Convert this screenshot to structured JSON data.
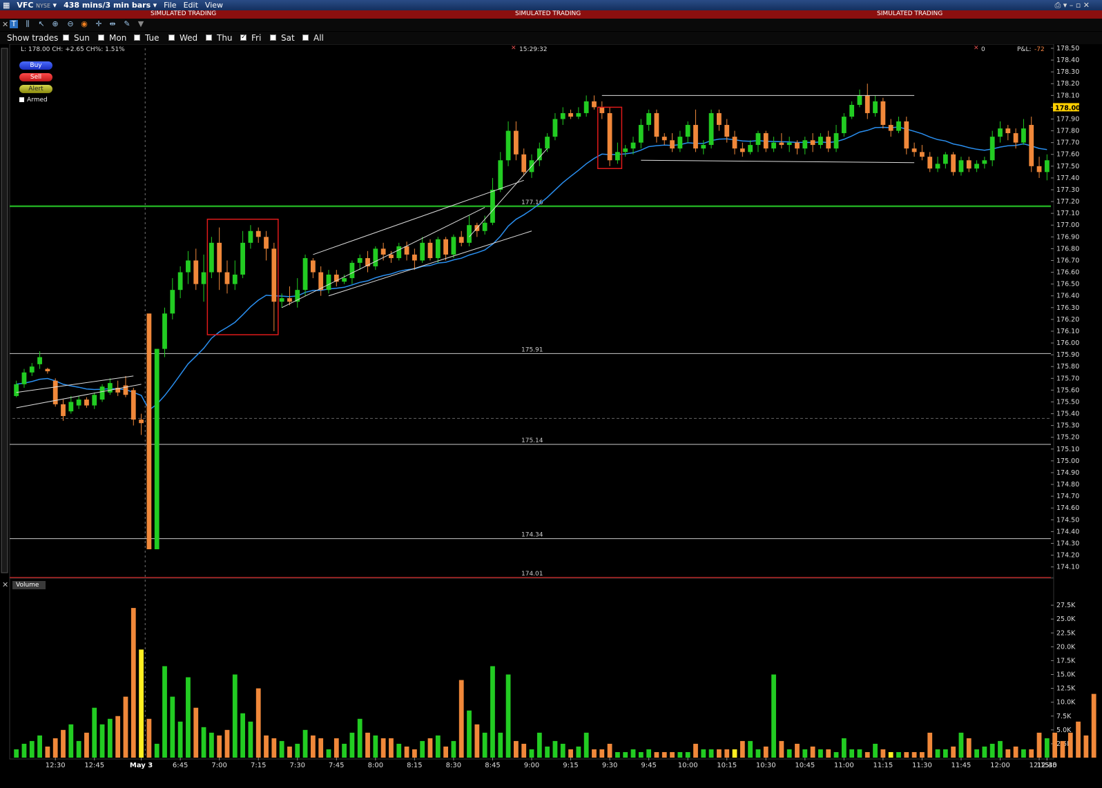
{
  "window": {
    "symbol": "VFC",
    "exchange": "NYSE",
    "period": "438 mins/3 min bars",
    "menu": [
      "File",
      "Edit",
      "View"
    ]
  },
  "banner": {
    "text": "SIMULATED TRADING"
  },
  "toolbar_icons": [
    "chart-icon",
    "bar-chart-icon",
    "cursor-icon",
    "zoom-in-icon",
    "zoom-out-icon",
    "globe-icon",
    "crosshair-icon",
    "arrows-icon",
    "wrench-icon",
    "dropdown-icon"
  ],
  "filters": {
    "label": "Show trades",
    "days": [
      {
        "name": "Sun",
        "checked": false
      },
      {
        "name": "Mon",
        "checked": false
      },
      {
        "name": "Tue",
        "checked": false
      },
      {
        "name": "Wed",
        "checked": false
      },
      {
        "name": "Thu",
        "checked": false
      },
      {
        "name": "Fri",
        "checked": true
      },
      {
        "name": "Sat",
        "checked": false
      },
      {
        "name": "All",
        "checked": false
      }
    ]
  },
  "info": {
    "quote": "L: 178.00   CH: +2.65  CH%: 1.51%",
    "time": "15:29:32",
    "position": "0",
    "pnl_label": "P&L:",
    "pnl_value": "-72"
  },
  "order_buttons": {
    "buy": "Buy",
    "sell": "Sell",
    "alert": "Alert",
    "armed": "Armed"
  },
  "volume_panel": {
    "label": "Volume"
  },
  "colors": {
    "up": "#22cc22",
    "down": "#f0883a",
    "ema": "#2a8ff0",
    "support": "#22aa22",
    "last_price_bg": "#ffd000",
    "boxes": "#e01a1a"
  },
  "chart_data": {
    "type": "candlestick",
    "ylim": [
      174.01,
      178.5
    ],
    "y_ticks": [
      "178.50",
      "178.40",
      "178.30",
      "178.20",
      "178.10",
      "178.00",
      "177.90",
      "177.80",
      "177.70",
      "177.60",
      "177.50",
      "177.40",
      "177.30",
      "177.20",
      "177.10",
      "177.00",
      "176.90",
      "176.80",
      "176.70",
      "176.60",
      "176.50",
      "176.40",
      "176.30",
      "176.20",
      "176.10",
      "176.00",
      "175.90",
      "175.80",
      "175.70",
      "175.60",
      "175.50",
      "175.40",
      "175.30",
      "175.20",
      "175.10",
      "175.00",
      "174.90",
      "174.80",
      "174.70",
      "174.60",
      "174.50",
      "174.40",
      "174.30",
      "174.20",
      "174.10"
    ],
    "last_price": "178.00",
    "x_ticks": [
      "12:30",
      "12:45",
      "May 3",
      "6:45",
      "7:00",
      "7:15",
      "7:30",
      "7:45",
      "8:00",
      "8:15",
      "8:30",
      "8:45",
      "9:00",
      "9:15",
      "9:30",
      "9:45",
      "10:00",
      "10:15",
      "10:30",
      "10:45",
      "11:00",
      "11:15",
      "11:30",
      "11:45",
      "12:00",
      "12:15",
      "12:30",
      "12:45"
    ],
    "levels": [
      {
        "value": 177.16,
        "label": "177.16"
      },
      {
        "value": 175.91,
        "label": "175.91"
      },
      {
        "value": 175.14,
        "label": "175.14"
      },
      {
        "value": 174.34,
        "label": "174.34"
      },
      {
        "value": 174.01,
        "label": "174.01"
      }
    ],
    "volume_ticks": [
      "27.5K",
      "25.0K",
      "22.5K",
      "20.0K",
      "17.5K",
      "15.0K",
      "12.5K",
      "10.0K",
      "7.5K",
      "5.0K",
      "2.5K"
    ],
    "volume_max": 30000,
    "candles": [
      [
        175.55,
        175.65,
        175.54,
        175.68
      ],
      [
        175.65,
        175.75,
        175.62,
        175.78
      ],
      [
        175.75,
        175.8,
        175.72,
        175.83
      ],
      [
        175.82,
        175.88,
        175.78,
        175.93
      ],
      [
        175.78,
        175.76,
        175.74,
        175.79
      ],
      [
        175.68,
        175.48,
        175.46,
        175.7
      ],
      [
        175.48,
        175.38,
        175.34,
        175.52
      ],
      [
        175.42,
        175.5,
        175.4,
        175.55
      ],
      [
        175.47,
        175.52,
        175.44,
        175.55
      ],
      [
        175.52,
        175.47,
        175.45,
        175.54
      ],
      [
        175.47,
        175.56,
        175.44,
        175.58
      ],
      [
        175.52,
        175.63,
        175.5,
        175.65
      ],
      [
        175.58,
        175.66,
        175.56,
        175.7
      ],
      [
        175.62,
        175.58,
        175.55,
        175.68
      ],
      [
        175.64,
        175.56,
        175.54,
        175.72
      ],
      [
        175.6,
        175.35,
        175.3,
        175.62
      ],
      [
        175.35,
        175.32,
        175.22,
        175.4
      ],
      [
        176.25,
        174.25,
        174.25,
        176.25
      ],
      [
        174.25,
        175.95,
        174.25,
        175.95
      ],
      [
        175.95,
        176.25,
        175.88,
        176.3
      ],
      [
        176.25,
        176.45,
        176.2,
        176.55
      ],
      [
        176.45,
        176.6,
        176.38,
        176.65
      ],
      [
        176.6,
        176.7,
        176.5,
        176.78
      ],
      [
        176.7,
        176.5,
        176.45,
        176.8
      ],
      [
        176.5,
        176.6,
        176.35,
        176.75
      ],
      [
        176.6,
        176.85,
        176.55,
        176.9
      ],
      [
        176.85,
        176.6,
        176.45,
        176.98
      ],
      [
        176.6,
        176.5,
        176.42,
        176.7
      ],
      [
        176.5,
        176.58,
        176.45,
        176.7
      ],
      [
        176.58,
        176.85,
        176.55,
        176.95
      ],
      [
        176.85,
        176.95,
        176.8,
        177.0
      ],
      [
        176.95,
        176.9,
        176.85,
        176.98
      ],
      [
        176.9,
        176.8,
        176.7,
        176.95
      ],
      [
        176.8,
        176.35,
        176.1,
        176.85
      ],
      [
        176.35,
        176.38,
        176.3,
        176.42
      ],
      [
        176.38,
        176.35,
        176.32,
        176.48
      ],
      [
        176.35,
        176.45,
        176.3,
        176.55
      ],
      [
        176.45,
        176.72,
        176.4,
        176.75
      ],
      [
        176.7,
        176.6,
        176.55,
        176.72
      ],
      [
        176.6,
        176.45,
        176.4,
        176.65
      ],
      [
        176.45,
        176.58,
        176.42,
        176.62
      ],
      [
        176.58,
        176.52,
        176.48,
        176.62
      ],
      [
        176.52,
        176.55,
        176.5,
        176.58
      ],
      [
        176.55,
        176.68,
        176.5,
        176.7
      ],
      [
        176.68,
        176.72,
        176.62,
        176.75
      ],
      [
        176.72,
        176.65,
        176.6,
        176.78
      ],
      [
        176.65,
        176.8,
        176.62,
        176.82
      ],
      [
        176.8,
        176.75,
        176.7,
        176.85
      ],
      [
        176.75,
        176.72,
        176.68,
        176.78
      ],
      [
        176.72,
        176.82,
        176.7,
        176.85
      ],
      [
        176.82,
        176.75,
        176.7,
        176.86
      ],
      [
        176.75,
        176.7,
        176.62,
        176.8
      ],
      [
        176.7,
        176.85,
        176.68,
        176.9
      ],
      [
        176.85,
        176.72,
        176.7,
        176.88
      ],
      [
        176.72,
        176.88,
        176.68,
        176.9
      ],
      [
        176.88,
        176.75,
        176.7,
        176.9
      ],
      [
        176.75,
        176.9,
        176.72,
        176.92
      ],
      [
        176.9,
        176.85,
        176.82,
        176.95
      ],
      [
        176.85,
        177.0,
        176.82,
        177.08
      ],
      [
        177.0,
        176.95,
        176.9,
        177.02
      ],
      [
        176.95,
        177.02,
        176.92,
        177.08
      ],
      [
        177.02,
        177.3,
        177.0,
        177.4
      ],
      [
        177.3,
        177.55,
        177.28,
        177.62
      ],
      [
        177.55,
        177.8,
        177.5,
        177.88
      ],
      [
        177.8,
        177.6,
        177.55,
        177.88
      ],
      [
        177.6,
        177.45,
        177.42,
        177.65
      ],
      [
        177.45,
        177.55,
        177.4,
        177.6
      ],
      [
        177.55,
        177.65,
        177.5,
        177.7
      ],
      [
        177.65,
        177.75,
        177.62,
        177.78
      ],
      [
        177.75,
        177.9,
        177.72,
        177.95
      ],
      [
        177.9,
        177.95,
        177.85,
        178.0
      ],
      [
        177.95,
        177.92,
        177.9,
        177.98
      ],
      [
        177.92,
        177.95,
        177.9,
        178.0
      ],
      [
        177.95,
        178.05,
        177.92,
        178.1
      ],
      [
        178.05,
        178.0,
        177.98,
        178.1
      ],
      [
        178.0,
        177.95,
        177.9,
        178.05
      ],
      [
        177.95,
        177.55,
        177.5,
        178.0
      ],
      [
        177.55,
        177.62,
        177.52,
        177.7
      ],
      [
        177.62,
        177.65,
        177.58,
        177.68
      ],
      [
        177.65,
        177.7,
        177.6,
        177.75
      ],
      [
        177.7,
        177.85,
        177.65,
        177.9
      ],
      [
        177.85,
        177.95,
        177.8,
        177.98
      ],
      [
        177.95,
        177.75,
        177.7,
        177.98
      ],
      [
        177.75,
        177.72,
        177.68,
        177.78
      ],
      [
        177.72,
        177.65,
        177.62,
        177.78
      ],
      [
        177.65,
        177.75,
        177.62,
        177.8
      ],
      [
        177.75,
        177.85,
        177.7,
        177.88
      ],
      [
        177.85,
        177.65,
        177.62,
        177.98
      ],
      [
        177.65,
        177.68,
        177.6,
        177.72
      ],
      [
        177.68,
        177.95,
        177.65,
        177.98
      ],
      [
        177.95,
        177.85,
        177.8,
        177.98
      ],
      [
        177.85,
        177.75,
        177.7,
        177.9
      ],
      [
        177.75,
        177.65,
        177.6,
        177.8
      ],
      [
        177.65,
        177.62,
        177.58,
        177.7
      ],
      [
        177.62,
        177.68,
        177.6,
        177.72
      ],
      [
        177.68,
        177.78,
        177.62,
        177.8
      ],
      [
        177.78,
        177.65,
        177.62,
        177.8
      ],
      [
        177.65,
        177.7,
        177.62,
        177.75
      ],
      [
        177.7,
        177.68,
        177.65,
        177.78
      ],
      [
        177.68,
        177.7,
        177.62,
        177.75
      ],
      [
        177.7,
        177.65,
        177.6,
        177.72
      ],
      [
        177.65,
        177.72,
        177.6,
        177.75
      ],
      [
        177.72,
        177.68,
        177.62,
        177.78
      ],
      [
        177.68,
        177.75,
        177.65,
        177.78
      ],
      [
        177.75,
        177.65,
        177.62,
        177.8
      ],
      [
        177.65,
        177.78,
        177.62,
        177.85
      ],
      [
        177.78,
        177.92,
        177.75,
        177.95
      ],
      [
        177.92,
        178.02,
        177.9,
        178.05
      ],
      [
        178.02,
        178.1,
        178.0,
        178.15
      ],
      [
        178.1,
        177.95,
        177.9,
        178.2
      ],
      [
        177.95,
        178.05,
        177.92,
        178.1
      ],
      [
        178.05,
        177.85,
        177.82,
        178.08
      ],
      [
        177.85,
        177.8,
        177.75,
        177.9
      ],
      [
        177.8,
        177.88,
        177.78,
        177.92
      ],
      [
        177.88,
        177.65,
        177.6,
        177.92
      ],
      [
        177.65,
        177.62,
        177.58,
        177.7
      ],
      [
        177.62,
        177.58,
        177.55,
        177.68
      ],
      [
        177.58,
        177.48,
        177.45,
        177.62
      ],
      [
        177.48,
        177.52,
        177.45,
        177.58
      ],
      [
        177.52,
        177.6,
        177.48,
        177.62
      ],
      [
        177.6,
        177.45,
        177.42,
        177.62
      ],
      [
        177.45,
        177.55,
        177.42,
        177.58
      ],
      [
        177.55,
        177.48,
        177.45,
        177.58
      ],
      [
        177.48,
        177.52,
        177.45,
        177.55
      ],
      [
        177.52,
        177.55,
        177.48,
        177.58
      ],
      [
        177.55,
        177.75,
        177.5,
        177.8
      ],
      [
        177.75,
        177.82,
        177.7,
        177.88
      ],
      [
        177.82,
        177.78,
        177.72,
        177.85
      ],
      [
        177.78,
        177.7,
        177.65,
        177.82
      ],
      [
        177.7,
        177.82,
        177.68,
        177.9
      ],
      [
        177.85,
        177.5,
        177.45,
        177.92
      ],
      [
        177.5,
        177.45,
        177.4,
        177.58
      ],
      [
        177.45,
        177.55,
        177.38,
        177.6
      ]
    ],
    "volumes": [
      1500,
      2500,
      3000,
      4000,
      2000,
      3500,
      5000,
      6000,
      3000,
      4500,
      9000,
      6000,
      7000,
      7500,
      11000,
      27000,
      19500,
      7000,
      2500,
      16500,
      11000,
      6500,
      14500,
      9000,
      5500,
      4500,
      4000,
      5000,
      15000,
      8000,
      6500,
      12500,
      4000,
      3500,
      3000,
      2000,
      2500,
      5000,
      4000,
      3500,
      1500,
      3500,
      2500,
      4500,
      7000,
      4500,
      4000,
      3500,
      3500,
      2500,
      2000,
      1500,
      3000,
      3500,
      4000,
      2000,
      3000,
      14000,
      8500,
      6000,
      4500,
      16500,
      4500,
      15000,
      3000,
      2500,
      1500,
      4500,
      2000,
      3000,
      2500,
      1500,
      2000,
      4500,
      1500,
      1500,
      2500,
      1000,
      1000,
      1500,
      1000,
      1500,
      1000,
      1000,
      1000,
      1000,
      1000,
      2500,
      1500,
      1500,
      1500,
      1500,
      1500,
      3000,
      3000,
      1500,
      2000,
      15000,
      3000,
      1500,
      2500,
      1500,
      2000,
      1500,
      1500,
      1000,
      3500,
      1500,
      1500,
      1000,
      2500,
      1500,
      1000,
      1000,
      1000,
      1000,
      1000,
      4500,
      1500,
      1500,
      2000,
      4500,
      3500,
      1500,
      2000,
      2500,
      3000,
      1500,
      2000,
      1500,
      1500,
      4500,
      3500,
      4500,
      3000,
      4500,
      6500,
      4000,
      11500
    ]
  }
}
